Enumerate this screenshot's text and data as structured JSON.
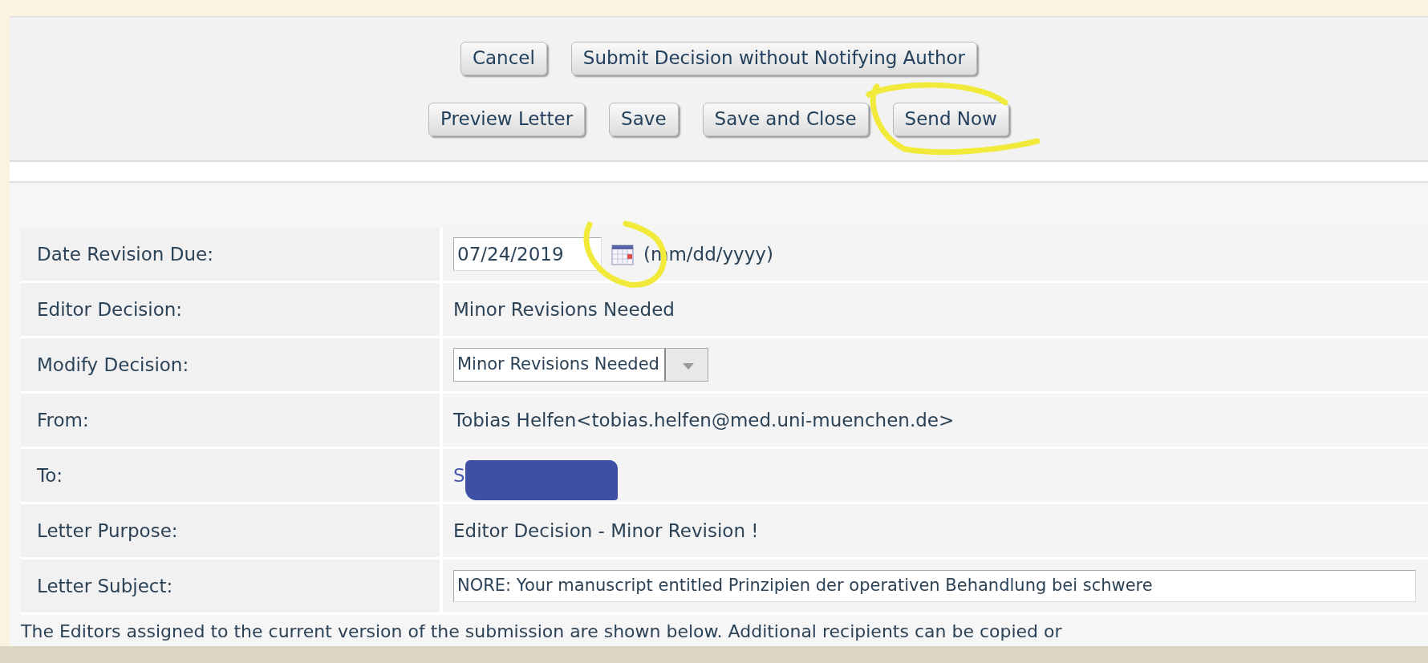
{
  "button_rows": [
    {
      "buttons": [
        {
          "label": "Cancel",
          "highlighted": false
        },
        {
          "label": "Submit Decision without Notifying Author",
          "highlighted": false
        }
      ]
    },
    {
      "buttons": [
        {
          "label": "Preview Letter",
          "highlighted": false
        },
        {
          "label": "Save",
          "highlighted": false
        },
        {
          "label": "Save and Close",
          "highlighted": false
        },
        {
          "label": "Send Now",
          "highlighted": true
        }
      ]
    }
  ],
  "fields": [
    {
      "kind": "date",
      "label": "Date Revision Due:",
      "value": "07/24/2019",
      "hint": "(mm/dd/yyyy)",
      "highlighted": true
    },
    {
      "kind": "text",
      "label": "Editor Decision:",
      "value": "Minor Revisions Needed"
    },
    {
      "kind": "select",
      "label": "Modify Decision:",
      "value": "Minor Revisions Needed"
    },
    {
      "kind": "text",
      "label": "From:",
      "value": "Tobias Helfen<tobias.helfen@med.uni-muenchen.de>"
    },
    {
      "kind": "redacted",
      "label": "To:",
      "value": "S"
    },
    {
      "kind": "text",
      "label": "Letter Purpose:",
      "value": "Editor Decision - Minor Revision !"
    },
    {
      "kind": "input",
      "label": "Letter Subject:",
      "value": "NORE: Your manuscript entitled Prinzipien der operativen Behandlung bei schwere"
    }
  ],
  "note": "The Editors assigned to the current version of the submission are shown below. Additional recipients can be copied or"
}
